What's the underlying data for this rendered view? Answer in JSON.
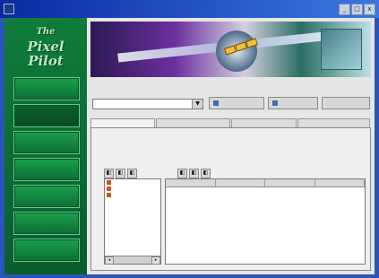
{
  "window": {
    "title": "",
    "buttons": [
      "_",
      "□",
      "x"
    ]
  },
  "sidebar": {
    "logo_line1": "The",
    "logo_line2": "Pixel",
    "logo_line3": "Pilot",
    "items": [
      {
        "label": ""
      },
      {
        "label": ""
      },
      {
        "label": ""
      },
      {
        "label": ""
      },
      {
        "label": ""
      },
      {
        "label": ""
      },
      {
        "label": ""
      }
    ]
  },
  "main": {
    "select_label": "",
    "select_value": "",
    "buttons": [
      {
        "label": ""
      },
      {
        "label": ""
      },
      {
        "label": ""
      }
    ],
    "tabs": [
      {
        "label": ""
      },
      {
        "label": ""
      },
      {
        "label": ""
      },
      {
        "label": ""
      }
    ],
    "panel_title": "",
    "left_header": "",
    "right_header": "",
    "tree_items": [
      {
        "label": ""
      },
      {
        "label": ""
      },
      {
        "label": ""
      }
    ],
    "columns": [
      "",
      "",
      "",
      ""
    ]
  },
  "colors": {
    "sidebar": "#0f7c3b",
    "titlebar": "#0a2aa0"
  }
}
